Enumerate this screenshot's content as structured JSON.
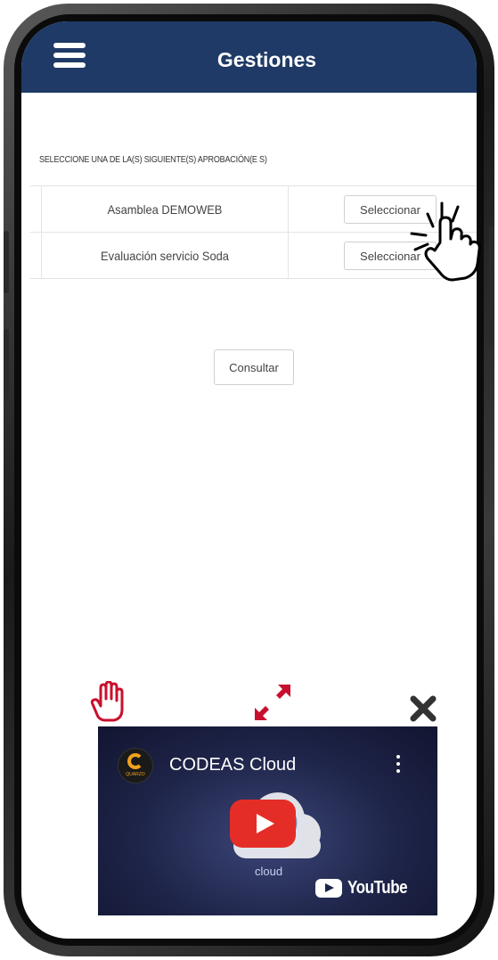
{
  "header": {
    "title": "Gestiones",
    "background": "#1f3a66"
  },
  "instruction": "SELECCIONE UNA DE LA(S) SIGUIENTE(S) APROBACIÓN(E S)",
  "approvals": [
    {
      "name": "Asamblea DEMOWEB",
      "action": "Seleccionar"
    },
    {
      "name": "Evaluación servicio Soda",
      "action": "Seleccionar"
    }
  ],
  "consultar_label": "Consultar",
  "video": {
    "title": "CODEAS Cloud",
    "channel_logo_text": "QUARZO",
    "cloud_subtitle": "cloud",
    "platform": "YouTube",
    "play_color": "#e52d27"
  },
  "icons": {
    "menu": "hamburger-menu-icon",
    "tap_hint": "tapping-hand-icon",
    "drag": "drag-hand-icon",
    "expand": "expand-icon",
    "close": "close-icon"
  },
  "accent_red": "#c8102e"
}
